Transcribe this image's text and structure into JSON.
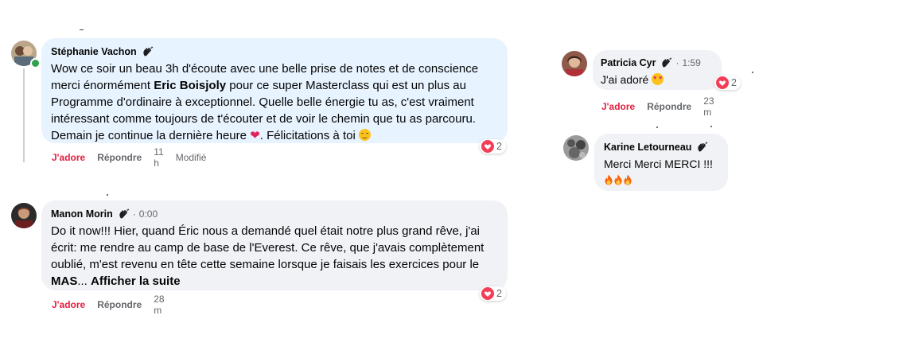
{
  "comments": [
    {
      "author": "Stéphanie Vachon",
      "text_1": "Wow ce soir un beau 3h d'écoute avec une belle prise de notes et de conscience",
      "text_2a": "merci énormément ",
      "mention": "Eric Boisjoly",
      "text_2b": " pour ce super Masterclass qui est un plus au",
      "text_3": "Programme d'ordinaire à exceptionnel. Quelle belle énergie tu as, c'est vraiment",
      "text_4": "intéressant comme toujours de t'écouter et de voir le chemin que tu as parcouru.",
      "text_5a": "Demain je continue la dernière heure",
      "text_5b": ". Félicitations à toi",
      "like": "J'adore",
      "reply": "Répondre",
      "time": "11 h",
      "edited": "Modifié",
      "reaction_count": "2"
    },
    {
      "author": "Manon Morin",
      "timestamp": "0:00",
      "text_1": "Do it now!!! Hier, quand Éric nous a demandé quel était notre plus grand rêve, j'ai",
      "text_2": "écrit: me rendre au camp de base de l'Everest. Ce rêve, que j'avais complètement",
      "text_3": "oublié, m'est revenu en tête cette semaine lorsque je faisais les exercices pour le",
      "text_4a": "MAS",
      "text_4b": "... ",
      "see_more": "Afficher la suite",
      "like": "J'adore",
      "reply": "Répondre",
      "time": "28 m",
      "reaction_count": "2"
    },
    {
      "author": "Patricia Cyr",
      "timestamp": "1:59",
      "text": "J'ai adoré",
      "like": "J'adore",
      "reply": "Répondre",
      "time": "23 m",
      "reaction_count": "2"
    },
    {
      "author": "Karine Letourneau",
      "text": "Merci Merci MERCI !!!"
    }
  ],
  "separator": "·",
  "colors": {
    "bubble_grey": "#f0f2f5",
    "bubble_blue": "#e7f3ff",
    "like_red": "#e41e3f",
    "meta_grey": "#65676b"
  },
  "icons": [
    "wave-badge-icon",
    "love-reaction-icon",
    "heart-emoji",
    "smile-emoji",
    "heart-face-emoji",
    "fire-emoji"
  ]
}
